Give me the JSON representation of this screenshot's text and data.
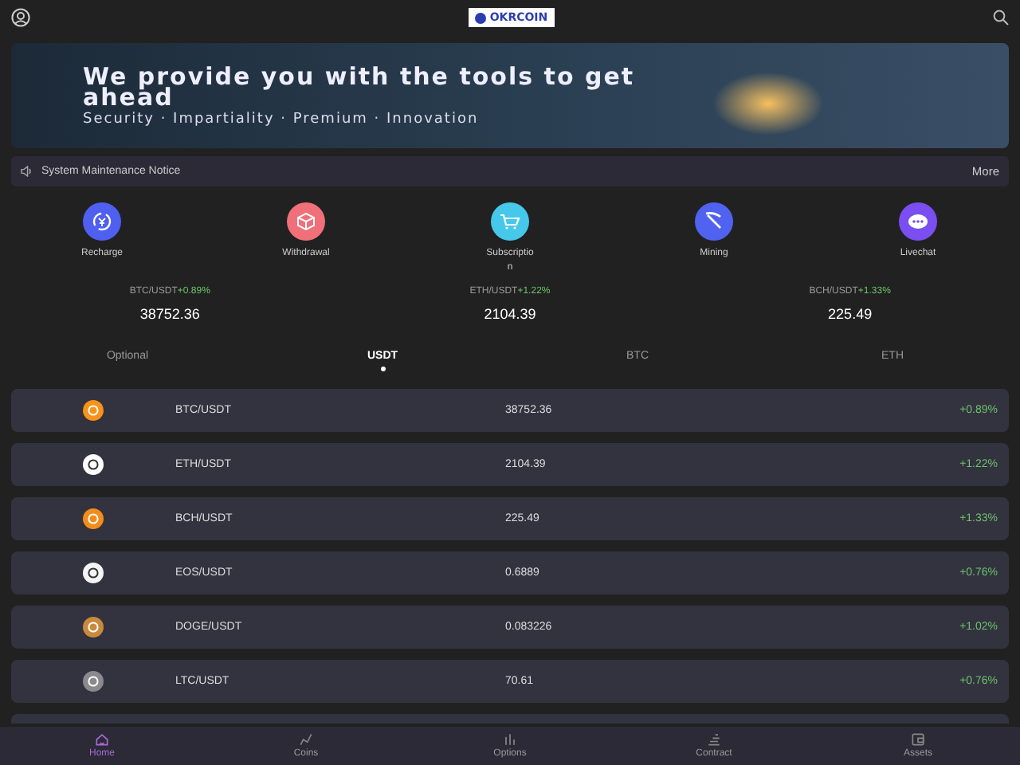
{
  "header": {
    "logo": "OKRCOIN"
  },
  "banner": {
    "headline": "We provide you with the tools to get ahead",
    "tagline": "Security · Impartiality · Premium · Innovation"
  },
  "notice": {
    "text": "System Maintenance Notice",
    "more": "More"
  },
  "quick_menu": [
    {
      "label": "Recharge",
      "color": "#4f5ff0"
    },
    {
      "label": "Withdrawal",
      "color": "#f0707a"
    },
    {
      "label": "Subscription",
      "color": "#45c8ea"
    },
    {
      "label": "Mining",
      "color": "#4f63f0"
    },
    {
      "label": "Livechat",
      "color": "#7a4ef0"
    }
  ],
  "tickers": [
    {
      "pair": "BTC/USDT",
      "change": "+0.89%",
      "price": "38752.36"
    },
    {
      "pair": "ETH/USDT",
      "change": "+1.22%",
      "price": "2104.39"
    },
    {
      "pair": "BCH/USDT",
      "change": "+1.33%",
      "price": "225.49"
    }
  ],
  "market_tabs": [
    {
      "label": "Optional",
      "selected": false
    },
    {
      "label": "USDT",
      "selected": true
    },
    {
      "label": "BTC",
      "selected": false
    },
    {
      "label": "ETH",
      "selected": false
    }
  ],
  "coins": [
    {
      "pair": "BTC/USDT",
      "price": "38752.36",
      "change": "+0.89%",
      "color": "#f7931a"
    },
    {
      "pair": "ETH/USDT",
      "price": "2104.39",
      "change": "+1.22%",
      "color": "#ffffff"
    },
    {
      "pair": "BCH/USDT",
      "price": "225.49",
      "change": "+1.33%",
      "color": "#f28c1c"
    },
    {
      "pair": "EOS/USDT",
      "price": "0.6889",
      "change": "+0.76%",
      "color": "#f4f4f4"
    },
    {
      "pair": "DOGE/USDT",
      "price": "0.083226",
      "change": "+1.02%",
      "color": "#c98a3c"
    },
    {
      "pair": "LTC/USDT",
      "price": "70.61",
      "change": "+0.76%",
      "color": "#8a8a8e"
    }
  ],
  "tab_bar": [
    {
      "label": "Home",
      "selected": true
    },
    {
      "label": "Coins",
      "selected": false
    },
    {
      "label": "Options",
      "selected": false
    },
    {
      "label": "Contract",
      "selected": false
    },
    {
      "label": "Assets",
      "selected": false
    }
  ]
}
